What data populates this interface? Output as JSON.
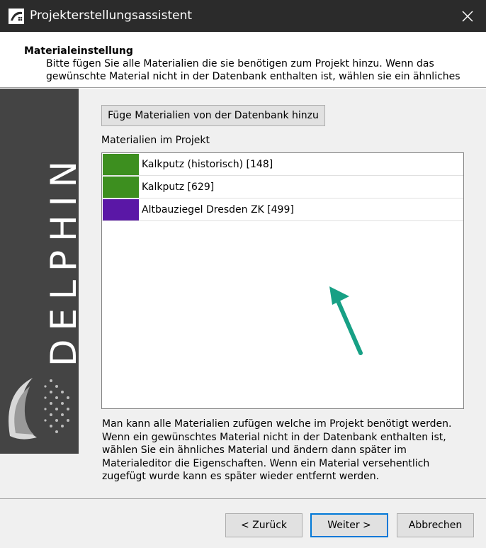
{
  "window": {
    "title": "Projekterstellungsassistent",
    "icon": "delphin-app-icon",
    "close_icon": "close-icon"
  },
  "header": {
    "title": "Materialeinstellung",
    "description_lines": [
      "Bitte fügen Sie alle Materialien die sie benötigen zum Projekt hinzu. Wenn das",
      "gewünschte Material nicht in der Datenbank enthalten ist, wählen sie ein ähnliches"
    ]
  },
  "sidebar": {
    "logo_text": "DELPHIN"
  },
  "main": {
    "add_button_label": "Füge Materialien von der Datenbank hinzu",
    "list_label": "Materialien im Projekt",
    "materials": [
      {
        "name": "Kalkputz (historisch) [148]",
        "color": "#3d8f1f"
      },
      {
        "name": "Kalkputz [629]",
        "color": "#3d8f1f"
      },
      {
        "name": "Altbauziegel Dresden ZK [499]",
        "color": "#5a17a6"
      }
    ],
    "info_lines": [
      "Man kann alle Materialien zufügen welche im Projekt benötigt werden.",
      "Wenn ein gewünschtes Material nicht in der Datenbank enthalten ist,",
      "wählen Sie ein ähnliches Material und ändern dann später im",
      "Materialeditor die Eigenschaften. Wenn ein Material versehentlich",
      "zugefügt wurde kann es später wieder entfernt werden."
    ],
    "annotation_color": "#17a085"
  },
  "footer": {
    "back_label": "< Zurück",
    "next_label": "Weiter >",
    "cancel_label": "Abbrechen"
  }
}
